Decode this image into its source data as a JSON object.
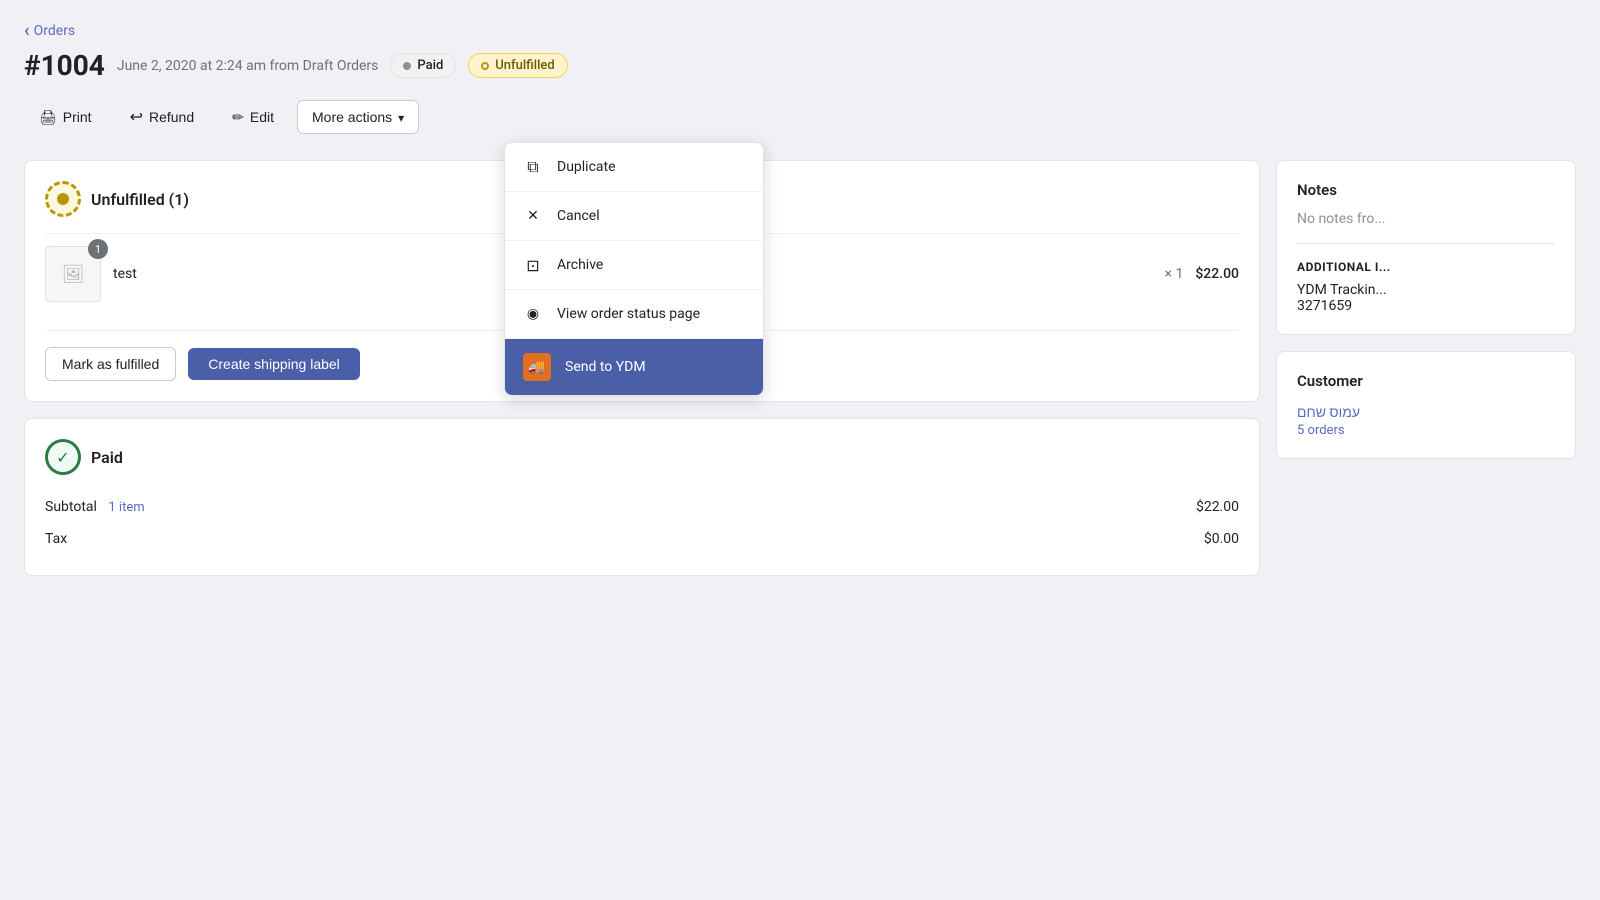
{
  "nav": {
    "back_label": "Orders"
  },
  "header": {
    "order_number": "#1004",
    "order_meta": "June 2, 2020 at 2:24 am from Draft Orders",
    "badge_paid": "Paid",
    "badge_unfulfilled": "Unfulfilled"
  },
  "toolbar": {
    "print_label": "Print",
    "refund_label": "Refund",
    "edit_label": "Edit",
    "more_actions_label": "More actions"
  },
  "dropdown": {
    "items": [
      {
        "id": "duplicate",
        "label": "Duplicate",
        "icon": "duplicate"
      },
      {
        "id": "cancel",
        "label": "Cancel",
        "icon": "cancel"
      },
      {
        "id": "archive",
        "label": "Archive",
        "icon": "archive"
      },
      {
        "id": "view-order-status",
        "label": "View order status page",
        "icon": "view"
      },
      {
        "id": "send-to-ydm",
        "label": "Send to YDM",
        "icon": "ydm",
        "highlighted": true
      }
    ]
  },
  "unfulfilled_card": {
    "title": "Unfulfilled (1)",
    "product": {
      "name": "test",
      "quantity": 1,
      "price": "$22.00",
      "multiplier": "× 1"
    },
    "btn_mark_fulfilled": "Mark as fulfilled",
    "btn_create_shipping": "Create shipping label"
  },
  "paid_card": {
    "title": "Paid",
    "subtotal_label": "Subtotal",
    "subtotal_sub": "1 item",
    "subtotal_value": "$22.00",
    "tax_label": "Tax",
    "tax_value": "$0.00"
  },
  "notes_card": {
    "title": "Notes",
    "empty_text": "No notes fro..."
  },
  "additional_section": {
    "title": "ADDITIONAL I...",
    "tracking_label": "YDM Trackin...",
    "tracking_value": "3271659"
  },
  "customer_card": {
    "title": "Customer",
    "name": "עמוס שחם",
    "orders_label": "5 orders"
  }
}
